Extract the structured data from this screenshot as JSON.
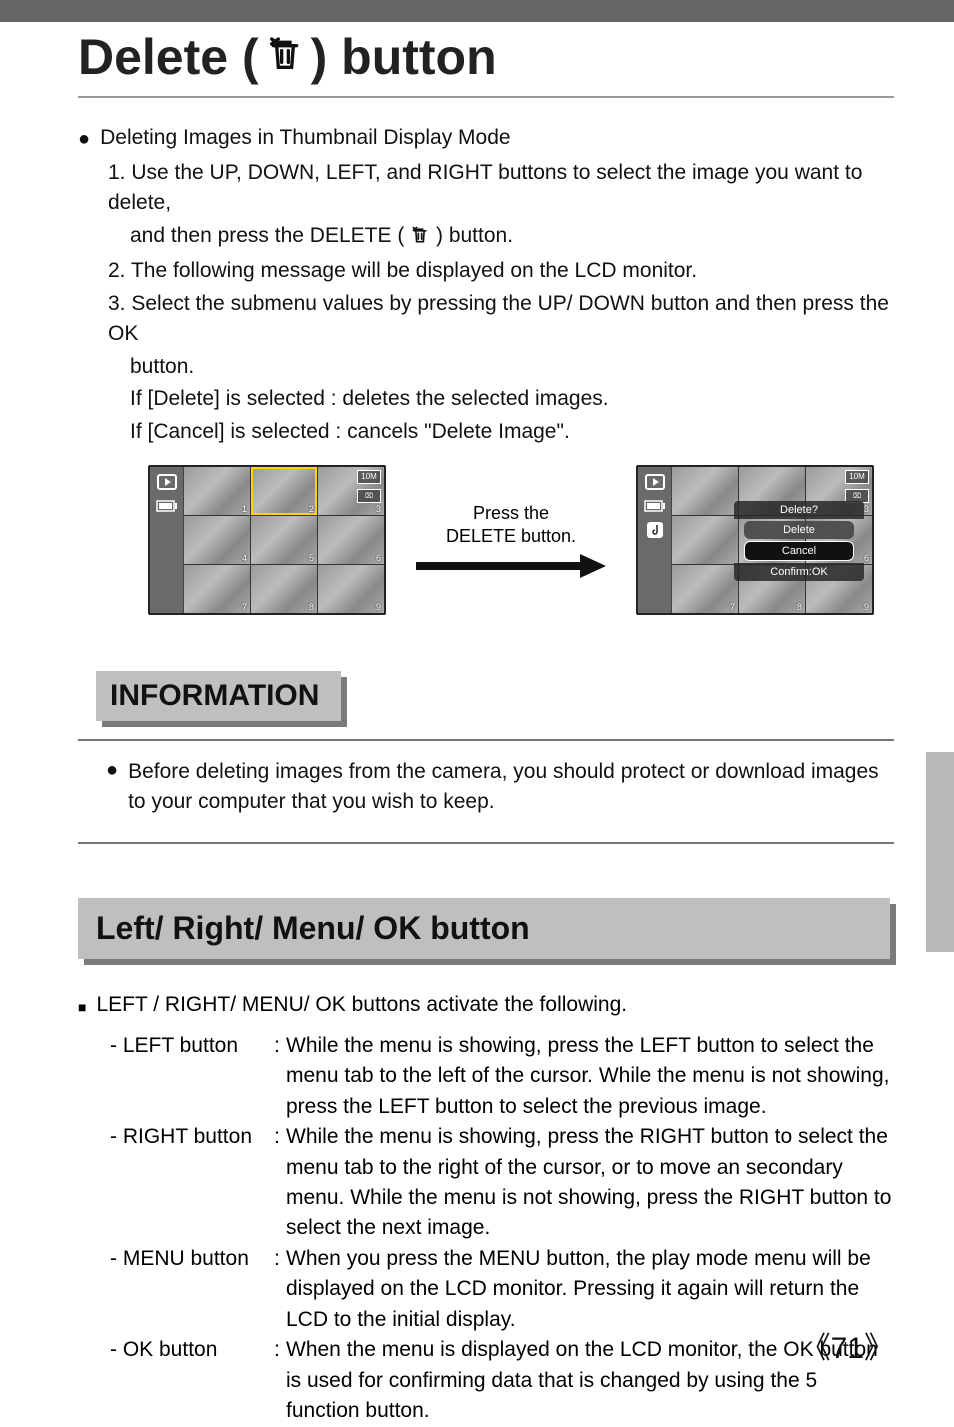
{
  "title": {
    "prefix": "Delete (",
    "suffix": ") button"
  },
  "icon_names": {
    "delete": "delete-icon"
  },
  "section1": {
    "bullet": "Deleting Images in Thumbnail Display Mode",
    "step1a": "1. Use the UP, DOWN, LEFT, and RIGHT buttons to select the image you want to delete,",
    "step1b": "and then press the DELETE (",
    "step1c": ") button.",
    "step2": "2. The following message will be displayed on the LCD monitor.",
    "step3a": "3. Select the submenu values by pressing the UP/ DOWN button and then press the OK",
    "step3b": "button.",
    "if_delete": "If [Delete] is selected   : deletes the selected images.",
    "if_cancel": "If [Cancel] is selected  : cancels \"Delete Image\"."
  },
  "shots": {
    "middle_line1": "Press the",
    "middle_line2": "DELETE button.",
    "thumbs": [
      "1",
      "2",
      "3",
      "4",
      "5",
      "6",
      "7",
      "8",
      "9"
    ],
    "dialog": {
      "title": "Delete?",
      "opt_delete": "Delete",
      "opt_cancel": "Cancel",
      "confirm": "Confirm:OK"
    }
  },
  "info": {
    "header": "INFORMATION",
    "text": "Before deleting images from the camera, you should protect or download images to your computer that you wish to keep."
  },
  "section2": {
    "header": "Left/ Right/ Menu/ OK button",
    "lead": "LEFT / RIGHT/ MENU/ OK buttons activate the following.",
    "defs": {
      "left": {
        "label": "- LEFT button",
        "text": "While the menu is showing, press the LEFT button to select the menu tab to the left of the cursor. While the menu is not showing, press the LEFT button to select the previous image."
      },
      "right": {
        "label": "- RIGHT button",
        "text": "While the menu is showing, press the RIGHT button to select the menu tab to the right of the cursor, or to move an secondary menu. While the menu is not showing, press the RIGHT button to select the next image."
      },
      "menu": {
        "label": "- MENU button",
        "text": "When you press the MENU button, the play mode menu will be displayed on the LCD monitor. Pressing it again will return the LCD to the initial display."
      },
      "ok": {
        "label": "- OK button",
        "text": "When the menu is displayed on the LCD monitor, the OK button is used for confirming data that is changed by using the 5 function button."
      }
    }
  },
  "page_number": "71"
}
